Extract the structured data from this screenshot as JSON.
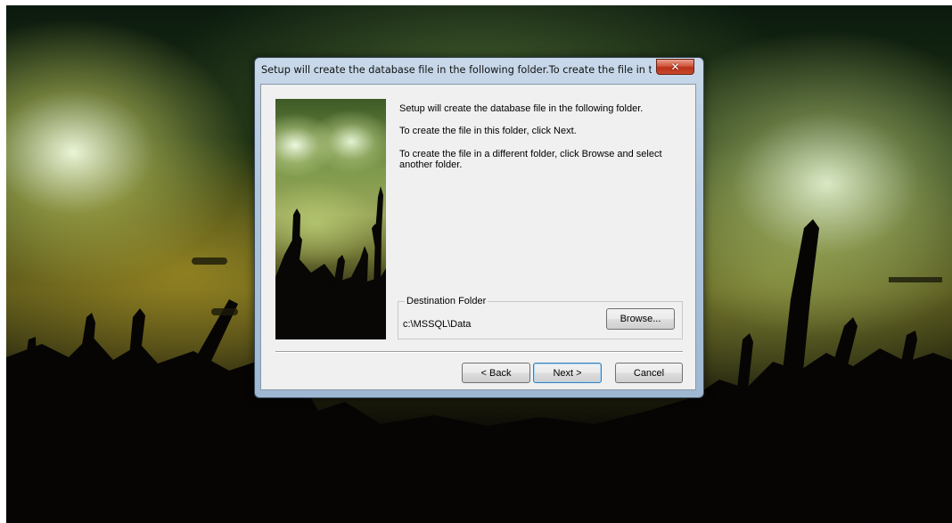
{
  "window": {
    "title": "Setup will create the database file in the following folder.To create the file in t...",
    "close_symbol": "✕"
  },
  "side_image": {
    "icon": "concert-crowd-image"
  },
  "instructions": {
    "line1": "Setup will create the database file in the following folder.",
    "line2": "To create the file in this folder, click Next.",
    "line3": "To create the file in a different folder, click Browse and select another folder."
  },
  "destination": {
    "group_label": "Destination Folder",
    "path": "c:\\MSSQL\\Data",
    "browse_label": "Browse..."
  },
  "buttons": {
    "back_label": "< Back",
    "next_label": "Next >",
    "cancel_label": "Cancel"
  },
  "colors": {
    "dialog_face": "#f0f0f0",
    "title_glass": "#aec5dd",
    "close_red": "#c8472d",
    "default_button_border": "#3c7fb1"
  }
}
